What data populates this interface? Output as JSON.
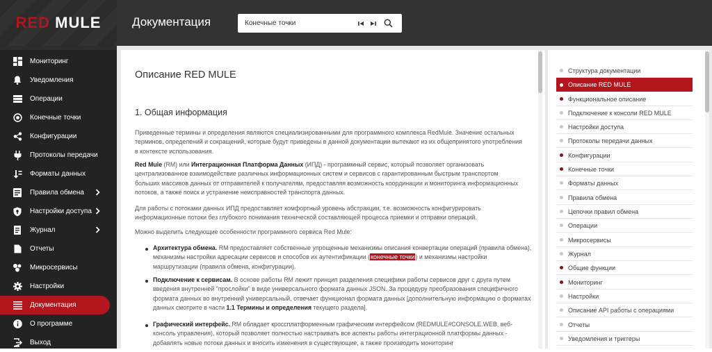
{
  "header": {
    "logo": "RED MULE",
    "title": "Документация",
    "search": {
      "value": "Конечные точки"
    }
  },
  "sidebar": {
    "items": [
      {
        "label": "Мониторинг",
        "icon": "dashboard-icon"
      },
      {
        "label": "Уведомления",
        "icon": "bell-icon"
      },
      {
        "label": "Операции",
        "icon": "list-icon"
      },
      {
        "label": "Конечные точки",
        "icon": "target-icon"
      },
      {
        "label": "Конфигурации",
        "icon": "nodes-icon"
      },
      {
        "label": "Протоколы передачи",
        "icon": "plug-icon"
      },
      {
        "label": "Форматы данных",
        "icon": "transform-icon"
      },
      {
        "label": "Правила обмена",
        "icon": "rules-icon",
        "chevron": true
      },
      {
        "label": "Настройки доступа",
        "icon": "shield-icon",
        "chevron": true
      },
      {
        "label": "Журнал",
        "icon": "journal-icon",
        "chevron": true
      },
      {
        "label": "Отчеты",
        "icon": "document-icon"
      },
      {
        "label": "Микросервисы",
        "icon": "microservices-icon"
      },
      {
        "label": "Настройки",
        "icon": "gear-icon"
      },
      {
        "label": "Документация",
        "icon": "docs-icon",
        "active": true
      },
      {
        "label": "О программе",
        "icon": "info-icon"
      },
      {
        "label": "Выход",
        "icon": "logout-icon"
      }
    ]
  },
  "doc": {
    "title": "Описание RED MULE",
    "section": "1. Общая информация",
    "p1": "Приведенные термины и определения являются специализированными для программного комплекса RedMule. Значение остальных терминов, определений и сокращений, которые будут приведены в данной документации вытекают из их общепринятого употребления в контексте использования.",
    "p2_b1": "Red Mule",
    "p2_t1": " (RM) или ",
    "p2_b2": "Интеграционная Платформа Данных",
    "p2_t2": " (ИПД) - программный сервис, который позволяет организовать централизованное взаимодействие различных информационных систем и сервисов с гарантированным быстрым транспортом больших массивов данных от отправителей к получателям, предоставляя возможность координации и мониторинга информационных потоков, а также поиск и устранение неисправностей транспорта данных.",
    "p3": "Для работы с потоками данных ИПД предоставляет комфортный уровень абстракции, т.е. возможность конфигурировать информационные потоки без глубокого понимания технической составляющей процесса приемки и отправки операций.",
    "p4": "Можно выделить следующие особенности программного сервиса Red Mule:",
    "li1_b": "Архитектура обмена.",
    "li1_t1": " RM предоставляет собственные упрощенные механизмы описания конвертации операций (правила обмена), механизмы настройки адресации сервисов и способов их аутентификации (",
    "li1_hl": "конечные точки",
    "li1_t2": ") и механизмы настройки маршрутизации (правила обмена, конфигурации).",
    "li2_b": "Подключение к сервисам.",
    "li2_t1": " В основе работы RM лежит принцип разделения специфики работы сервисов друг с друга путем введения внутренней \"прослойки\" в виде универсального формата данных JSON. За процедуру преобразования специфичного формата данных во внутренний универсальный, отвечает функционал формата данных [дополнительную информацию о форматах данных смотрите в части ",
    "li2_b2": "1.1 Термины и определения",
    "li2_t2": " текущего раздела].",
    "li3_b": "Графический интерфейс.",
    "li3_t1": " RM обладает кроссплатформенным графическим интерфейсом (REDMULE#CONSOLE.WEB, веб-консоль управления), который позволяет полностью настраивать все аспекты работы интеграционной платформы данных - добавлять новые потоки данных и вносить изменения в существующие, а также производить мониторинг"
  },
  "toc": {
    "items": [
      {
        "label": "Структура документации",
        "dot": "grey"
      },
      {
        "label": "Описание RED MULE",
        "dot": "red",
        "active": true
      },
      {
        "label": "Функциональное описание",
        "dot": "red"
      },
      {
        "label": "Подключение к консоли RED MULE",
        "dot": "grey"
      },
      {
        "label": "Настройки доступа",
        "dot": "grey"
      },
      {
        "label": "Протоколы передачи данных",
        "dot": "grey"
      },
      {
        "label": "Конфигурации",
        "dot": "red"
      },
      {
        "label": "Конечные точки",
        "dot": "red"
      },
      {
        "label": "Форматы данных",
        "dot": "grey"
      },
      {
        "label": "Правила обмена",
        "dot": "grey"
      },
      {
        "label": "Цепочки правил обмена",
        "dot": "grey"
      },
      {
        "label": "Операции",
        "dot": "grey"
      },
      {
        "label": "Микросервисы",
        "dot": "grey"
      },
      {
        "label": "Журнал",
        "dot": "grey"
      },
      {
        "label": "Общие функции",
        "dot": "red"
      },
      {
        "label": "Мониторинг",
        "dot": "red"
      },
      {
        "label": "Настройки",
        "dot": "grey"
      },
      {
        "label": "Описание API работы с операциями",
        "dot": "grey"
      },
      {
        "label": "Отчеты",
        "dot": "grey"
      },
      {
        "label": "Уведомления и триггеры",
        "dot": "grey"
      }
    ]
  }
}
